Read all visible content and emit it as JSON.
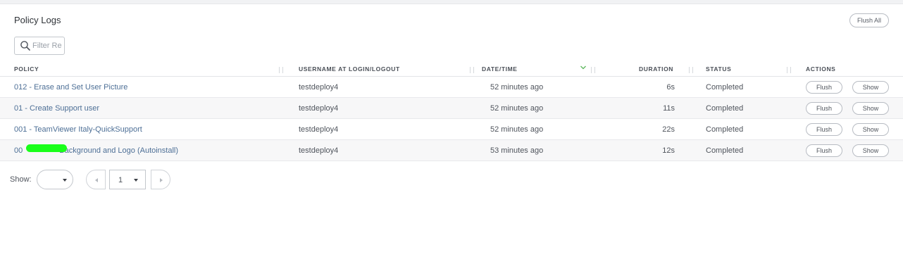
{
  "page": {
    "title": "Policy Logs",
    "flush_all_label": "Flush All"
  },
  "filter": {
    "placeholder": "Filter Re"
  },
  "table": {
    "columns": [
      "POLICY",
      "USERNAME AT LOGIN/LOGOUT",
      "DATE/TIME",
      "DURATION",
      "STATUS",
      "ACTIONS"
    ],
    "sort_column": "DATE/TIME",
    "rows": [
      {
        "policy": "012 - Erase and Set User Picture",
        "username": "testdeploy4",
        "datetime": "52 minutes ago",
        "duration": "6s",
        "status": "Completed",
        "flush": "Flush",
        "show": "Show"
      },
      {
        "policy": "01 - Create Support user",
        "username": "testdeploy4",
        "datetime": "52 minutes ago",
        "duration": "11s",
        "status": "Completed",
        "flush": "Flush",
        "show": "Show"
      },
      {
        "policy": "001 - TeamViewer Italy-QuickSupport",
        "username": "testdeploy4",
        "datetime": "52 minutes ago",
        "duration": "22s",
        "status": "Completed",
        "flush": "Flush",
        "show": "Show"
      },
      {
        "policy_prefix": "00",
        "policy_suffix": "Background and Logo (Autoinstall)",
        "username": "testdeploy4",
        "datetime": "53 minutes ago",
        "duration": "12s",
        "status": "Completed",
        "flush": "Flush",
        "show": "Show"
      }
    ]
  },
  "pagination": {
    "show_label": "Show:",
    "page_size_value": "",
    "current_page": "1"
  },
  "colors": {
    "link": "#4d6f96",
    "redaction": "#1aff1a",
    "sort_indicator": "#5bb75b"
  },
  "icons": {
    "filter": "search-icon",
    "sort": "chevron-down-icon",
    "prev": "caret-left-icon",
    "next": "caret-right-icon"
  }
}
